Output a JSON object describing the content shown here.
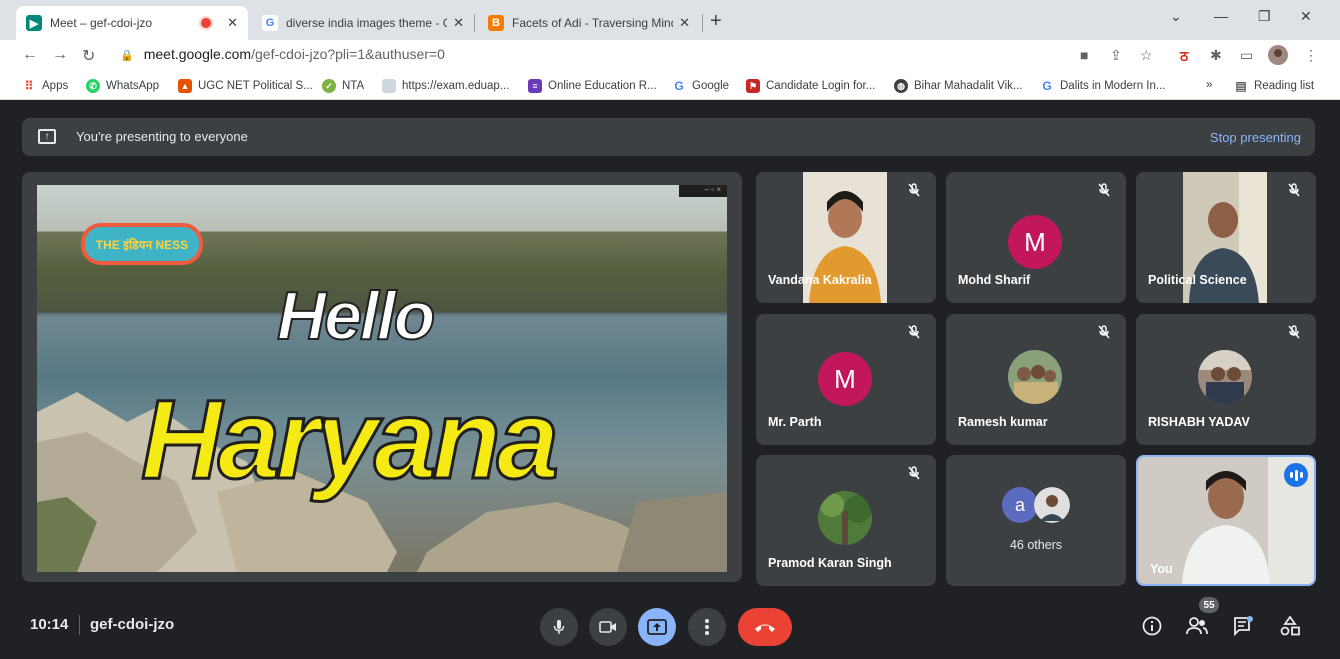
{
  "browser": {
    "tabs": [
      {
        "title": "Meet – gef-cdoi-jzo",
        "active": true,
        "recording": true
      },
      {
        "title": "diverse india images theme - Go",
        "active": false
      },
      {
        "title": "Facets of Adi - Traversing Mind: T",
        "active": false
      }
    ],
    "url_host": "meet.google.com",
    "url_path": "/gef-cdoi-jzo?pli=1&authuser=0",
    "bookmarks": [
      "Apps",
      "WhatsApp",
      "UGC NET Political S...",
      "NTA",
      "https://exam.eduap...",
      "Online Education R...",
      "Google",
      "Candidate Login for...",
      "Bihar Mahadalit Vik...",
      "Dalits in Modern In..."
    ],
    "reading_list": "Reading list"
  },
  "meet": {
    "banner_text": "You're presenting to everyone",
    "stop_presenting": "Stop presenting",
    "slide": {
      "logo": "THE इंडियन NESS",
      "hello": "Hello",
      "haryana": "Haryana"
    },
    "participants": [
      "Vandana Kakralia",
      "Mohd Sharif",
      "Political Science",
      "Mr. Parth",
      "Ramesh kumar",
      "RISHABH YADAV",
      "Pramod Karan Singh"
    ],
    "avatar_letter": "M",
    "others_letter": "a",
    "others_text": "46 others",
    "you_label": "You",
    "time": "10:14",
    "meeting_code": "gef-cdoi-jzo",
    "participant_count": "55"
  },
  "colors": {
    "meet_bg": "#202124",
    "tile_bg": "#3c4043",
    "accent_blue": "#8ab4f8",
    "end_call_red": "#ea4335",
    "avatar_pink": "#c2185b"
  }
}
